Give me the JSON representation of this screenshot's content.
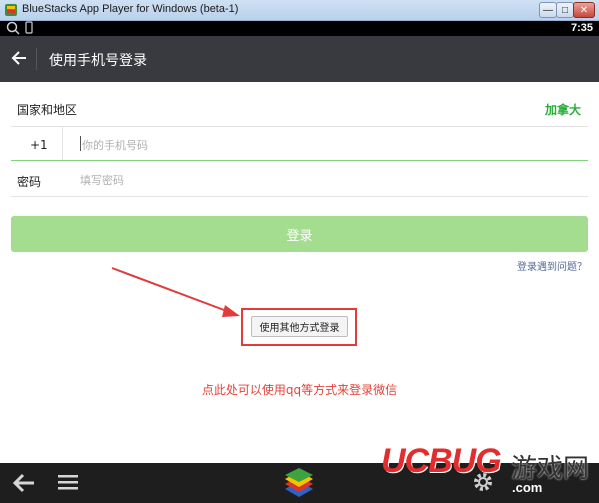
{
  "window": {
    "title": "BlueStacks App Player for Windows (beta-1)",
    "min_label": "—",
    "max_label": "□",
    "close_label": "✕"
  },
  "statusbar": {
    "time": "7:35"
  },
  "appbar": {
    "title": "使用手机号登录"
  },
  "form": {
    "country_label": "国家和地区",
    "country_value": "加拿大",
    "country_code": "+1",
    "phone_placeholder": "你的手机号码",
    "password_label": "密码",
    "password_placeholder": "填写密码",
    "login_label": "登录",
    "trouble_link": "登录遇到问题？",
    "other_login_label": "使用其他方式登录"
  },
  "annotation": {
    "hint": "点此处可以使用qq等方式来登录微信",
    "color": "#e0443b"
  },
  "watermark": {
    "brand": "UCBUG",
    "cn_text": "游戏网",
    "suffix": ".com"
  },
  "colors": {
    "accent_green": "#27ae36",
    "login_button": "#a4dd8f",
    "appbar": "#393a3f",
    "link": "#576b95"
  }
}
